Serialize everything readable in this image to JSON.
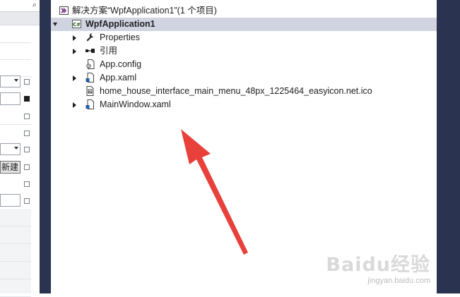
{
  "solution": {
    "title": "解决方案“WpfApplication1”(1 个项目)"
  },
  "project": {
    "name": "WpfApplication1",
    "badge": "C#"
  },
  "tree": [
    {
      "label": "Properties",
      "icon": "wrench-icon",
      "expander": "collapsed"
    },
    {
      "label": "引用",
      "icon": "references-icon",
      "expander": "collapsed"
    },
    {
      "label": "App.config",
      "icon": "config-file-icon",
      "expander": "none"
    },
    {
      "label": "App.xaml",
      "icon": "xaml-file-icon",
      "expander": "collapsed"
    },
    {
      "label": "home_house_interface_main_menu_48px_1225464_easyicon.net.ico",
      "icon": "ico-file-icon",
      "expander": "none"
    },
    {
      "label": "MainWindow.xaml",
      "icon": "xaml-file-icon",
      "expander": "collapsed"
    }
  ],
  "left_panel": {
    "new_button_label": "新建"
  },
  "annotation": {
    "arrow_color": "#e8403a"
  },
  "colors": {
    "frame": "#2a3451",
    "selection": "#cfd4e0"
  },
  "watermark": {
    "logo": "Baidu经验",
    "url": "jingyan.baidu.com"
  }
}
